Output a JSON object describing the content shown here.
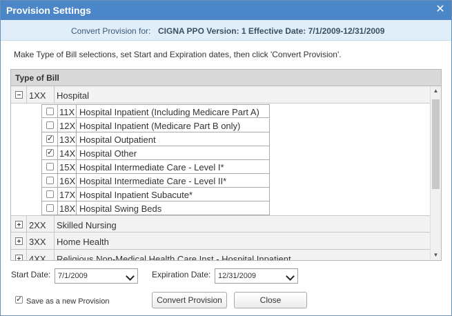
{
  "dialog": {
    "title": "Provision Settings",
    "close_glyph": "✕"
  },
  "provision": {
    "label": "Convert Provision for:",
    "value": "CIGNA PPO Version: 1 Effective Date: 7/1/2009-12/31/2009"
  },
  "instructions": "Make Type of Bill selections, set Start and Expiration dates, then click 'Convert Provision'.",
  "grid": {
    "header": "Type of Bill",
    "groups": [
      {
        "code": "1XX",
        "name": "Hospital",
        "expanded": true,
        "items": [
          {
            "code": "11X",
            "name": "Hospital Inpatient (Including Medicare Part A)",
            "checked": false
          },
          {
            "code": "12X",
            "name": "Hospital Inpatient (Medicare Part B only)",
            "checked": false
          },
          {
            "code": "13X",
            "name": "Hospital Outpatient",
            "checked": true
          },
          {
            "code": "14X",
            "name": "Hospital Other",
            "checked": true
          },
          {
            "code": "15X",
            "name": "Hospital Intermediate Care - Level I*",
            "checked": false
          },
          {
            "code": "16X",
            "name": "Hospital Intermediate Care - Level II*",
            "checked": false
          },
          {
            "code": "17X",
            "name": "Hospital Inpatient Subacute*",
            "checked": false
          },
          {
            "code": "18X",
            "name": "Hospital Swing Beds",
            "checked": false
          }
        ]
      },
      {
        "code": "2XX",
        "name": "Skilled Nursing",
        "expanded": false
      },
      {
        "code": "3XX",
        "name": "Home Health",
        "expanded": false
      },
      {
        "code": "4XX",
        "name": "Religious Non-Medical Health Care Inst - Hospital Inpatient",
        "expanded": false
      }
    ]
  },
  "form": {
    "start_label": "Start Date:",
    "start_value": "7/1/2009",
    "expiration_label": "Expiration Date:",
    "expiration_value": "12/31/2009",
    "save_label": "Save as a new Provision",
    "save_checked": true
  },
  "buttons": {
    "convert": "Convert Provision",
    "close": "Close"
  },
  "icons": {
    "collapse": "minus-box-icon",
    "expand": "plus-box-icon",
    "dropdown": "chevron-down-icon"
  },
  "colors": {
    "titlebar": "#4a86c8",
    "provision_bar": "#dfeef9"
  }
}
